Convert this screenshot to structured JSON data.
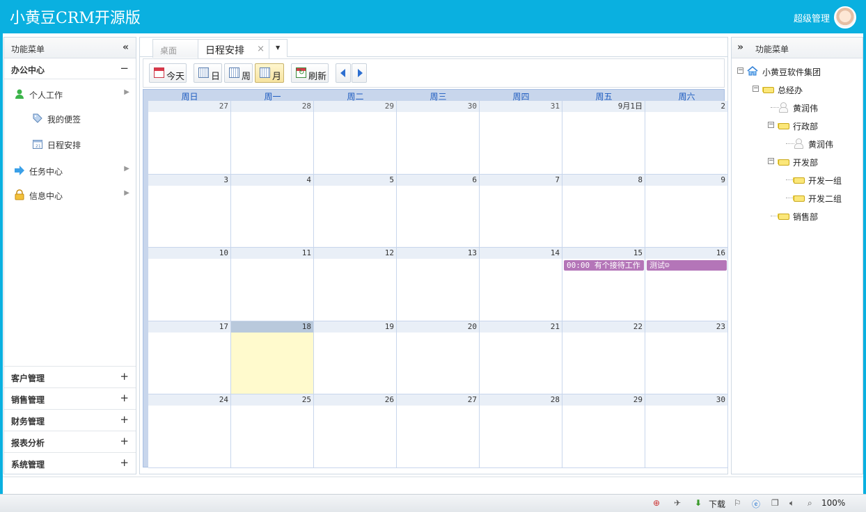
{
  "header": {
    "app_title": "小黄豆CRM开源版",
    "user_name": "超级管理"
  },
  "left_panel": {
    "title": "功能菜单",
    "office_group": "办公中心",
    "items": [
      {
        "label": "个人工作",
        "icon": "person-icon"
      },
      {
        "label": "我的便签",
        "icon": "tag-icon"
      },
      {
        "label": "日程安排",
        "icon": "calendar-icon"
      },
      {
        "label": "任务中心",
        "icon": "arrow-icon"
      },
      {
        "label": "信息中心",
        "icon": "lock-icon"
      }
    ],
    "bottom_groups": [
      "客户管理",
      "销售管理",
      "财务管理",
      "报表分析",
      "系统管理"
    ]
  },
  "tabs": [
    {
      "label": "桌面"
    },
    {
      "label": "日程安排"
    }
  ],
  "toolbar": {
    "today": "今天",
    "day": "日",
    "week": "周",
    "month": "月",
    "refresh": "刷新"
  },
  "calendar": {
    "weekdays": [
      "周日",
      "周一",
      "周二",
      "周三",
      "周四",
      "周五",
      "周六"
    ],
    "weeks": [
      [
        "27",
        "28",
        "29",
        "30",
        "31",
        "9月1日",
        "2"
      ],
      [
        "3",
        "4",
        "5",
        "6",
        "7",
        "8",
        "9"
      ],
      [
        "10",
        "11",
        "12",
        "13",
        "14",
        "15",
        "16"
      ],
      [
        "17",
        "18",
        "19",
        "20",
        "21",
        "22",
        "23"
      ],
      [
        "24",
        "25",
        "26",
        "27",
        "28",
        "29",
        "30"
      ]
    ],
    "today": "18",
    "events": [
      {
        "text": "00:00 有个接待工作",
        "color": "#b475b8"
      },
      {
        "text": "测试☺",
        "color": "#b475b8"
      }
    ]
  },
  "right_panel": {
    "title": "功能菜单",
    "tree": [
      {
        "label": "小黄豆软件集团",
        "icon": "home-icon"
      },
      {
        "label": "总经办",
        "icon": "folder-icon"
      },
      {
        "label": "黄润伟",
        "icon": "user-icon"
      },
      {
        "label": "行政部",
        "icon": "folder-icon"
      },
      {
        "label": "黄润伟",
        "icon": "user-icon"
      },
      {
        "label": "开发部",
        "icon": "folder-icon"
      },
      {
        "label": "开发一组",
        "icon": "folder-icon"
      },
      {
        "label": "开发二组",
        "icon": "folder-icon"
      },
      {
        "label": "销售部",
        "icon": "folder-icon"
      }
    ]
  },
  "statusbar": {
    "download": "下载",
    "zoom": "100%"
  },
  "colors": {
    "header": "#0ab0e0",
    "event": "#b475b8",
    "today": "#fffacd"
  }
}
